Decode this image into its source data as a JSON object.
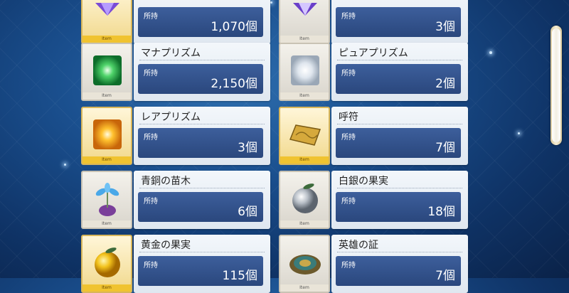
{
  "items": [
    {
      "name": "",
      "label": "所持",
      "qty": "1,070個",
      "icon": "gem-purple-icon",
      "rarity": "gold"
    },
    {
      "name": "",
      "label": "所持",
      "qty": "3個",
      "icon": "gem-purple-icon",
      "rarity": "silver"
    },
    {
      "name": "マナプリズム",
      "label": "所持",
      "qty": "2,150個",
      "icon": "mana-prism-icon",
      "rarity": "silver"
    },
    {
      "name": "ピュアプリズム",
      "label": "所持",
      "qty": "2個",
      "icon": "pure-prism-icon",
      "rarity": "silver"
    },
    {
      "name": "レアプリズム",
      "label": "所持",
      "qty": "3個",
      "icon": "rare-prism-icon",
      "rarity": "gold"
    },
    {
      "name": "呼符",
      "label": "所持",
      "qty": "7個",
      "icon": "summon-ticket-icon",
      "rarity": "gold"
    },
    {
      "name": "青銅の苗木",
      "label": "所持",
      "qty": "6個",
      "icon": "bronze-sapling-icon",
      "rarity": "silver"
    },
    {
      "name": "白銀の果実",
      "label": "所持",
      "qty": "18個",
      "icon": "silver-fruit-icon",
      "rarity": "silver"
    },
    {
      "name": "黄金の果実",
      "label": "所持",
      "qty": "115個",
      "icon": "golden-fruit-icon",
      "rarity": "gold"
    },
    {
      "name": "英雄の証",
      "label": "所持",
      "qty": "7個",
      "icon": "heroic-proof-icon",
      "rarity": "silver"
    }
  ],
  "tag": "Item",
  "colors": {
    "accent": "#2a477d",
    "gold": "#f0c330"
  }
}
